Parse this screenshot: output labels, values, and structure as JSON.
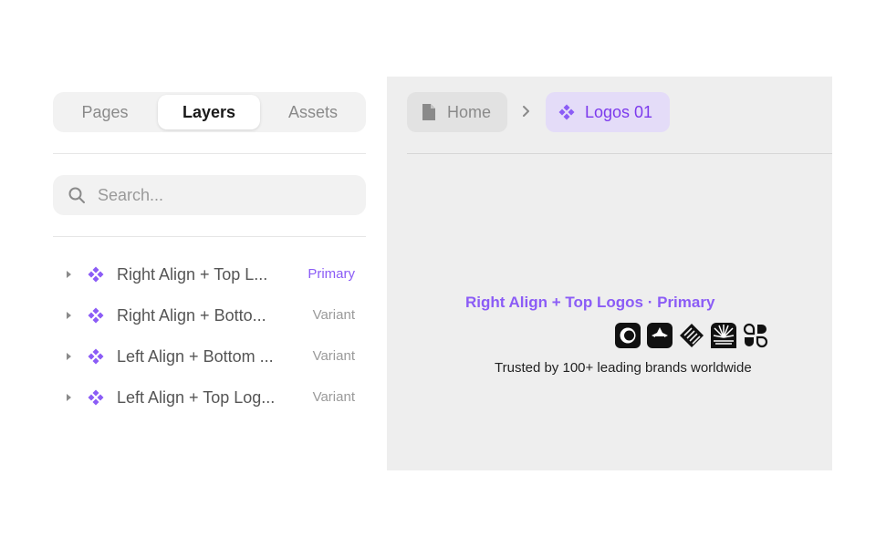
{
  "sidebar": {
    "tabs": [
      {
        "label": "Pages",
        "active": false
      },
      {
        "label": "Layers",
        "active": true
      },
      {
        "label": "Assets",
        "active": false
      }
    ],
    "search": {
      "placeholder": "Search...",
      "value": ""
    },
    "layers": [
      {
        "name": "Right Align + Top L...",
        "tag": "Primary"
      },
      {
        "name": "Right Align + Botto...",
        "tag": "Variant"
      },
      {
        "name": "Left Align + Bottom ...",
        "tag": "Variant"
      },
      {
        "name": "Left Align + Top Log...",
        "tag": "Variant"
      }
    ]
  },
  "breadcrumb": {
    "home": "Home",
    "current": "Logos 01"
  },
  "canvas": {
    "frame_label": "Right Align + Top Logos · Primary",
    "logos": [
      "circle-ring-logo",
      "rounded-star-logo",
      "stripe-diamond-logo",
      "sunburst-logo",
      "blob-clover-logo"
    ],
    "tagline": "Trusted by 100+ leading brands worldwide"
  },
  "colors": {
    "accent": "#8b5cf6",
    "accent_bg": "#e4dcf8",
    "canvas_bg": "#eeeeee",
    "panel_bg": "#f2f2f2"
  }
}
